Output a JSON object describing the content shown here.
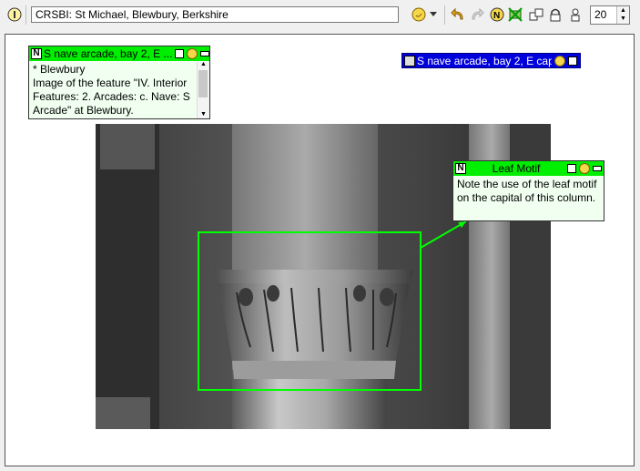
{
  "toolbar": {
    "title_value": "CRSBI: St Michael, Blewbury, Berkshire",
    "zoom_value": "20",
    "icons": [
      "info-icon",
      "annotate-icon",
      "dropdown-arrow-icon",
      "undo-icon",
      "redo-icon",
      "new-note-icon",
      "delete-note-icon",
      "copy-icon",
      "lock-icon",
      "person-icon"
    ]
  },
  "notes": {
    "main": {
      "title": "S nave arcade, bay 2, E ...",
      "body": "* Blewbury\nImage of the feature \"IV. Interior Features: 2. Arcades: c. Nave: S Arcade\" at Blewbury."
    },
    "collapsed": {
      "title": "S nave arcade, bay 2, E cap..."
    },
    "leaf": {
      "title": "Leaf Motif",
      "body": "Note the use of the leaf motif on the capital of this column."
    }
  },
  "colors": {
    "note_header": "#00ee00",
    "collapsed_note": "#0000dd",
    "highlight_box": "#00ff00"
  }
}
